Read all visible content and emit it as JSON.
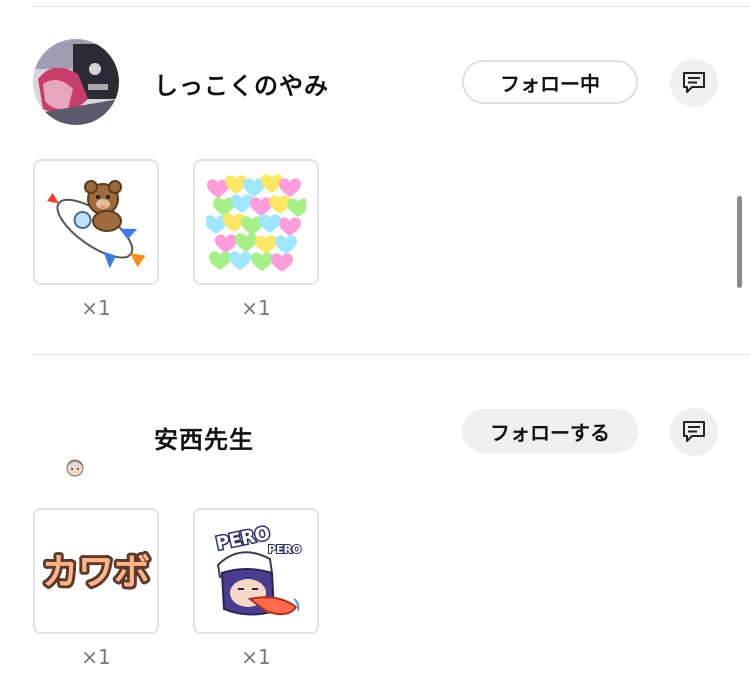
{
  "users": [
    {
      "name": "しっこくのやみ",
      "follow_label": "フォロー中",
      "message_icon": "chat-bubble-icon",
      "avatar_icon": "user-avatar-photo",
      "gifts": [
        {
          "icon": "teddy-bear-rocket-sticker",
          "count": "×1"
        },
        {
          "icon": "colorful-hearts-sticker",
          "count": "×1"
        }
      ]
    },
    {
      "name": "安西先生",
      "follow_label": "フォローする",
      "message_icon": "chat-bubble-icon",
      "avatar_icon": "small-character-avatar",
      "gifts": [
        {
          "icon": "kawabo-text-sticker",
          "count": "×1",
          "text": "カワボ"
        },
        {
          "icon": "pero-pero-character-sticker",
          "count": "×1",
          "text_top": "PERO",
          "text_sub": "PERO"
        }
      ]
    }
  ],
  "colors": {
    "border": "#e3e3e3",
    "button_gray": "#efefef",
    "count_text": "#777777"
  }
}
